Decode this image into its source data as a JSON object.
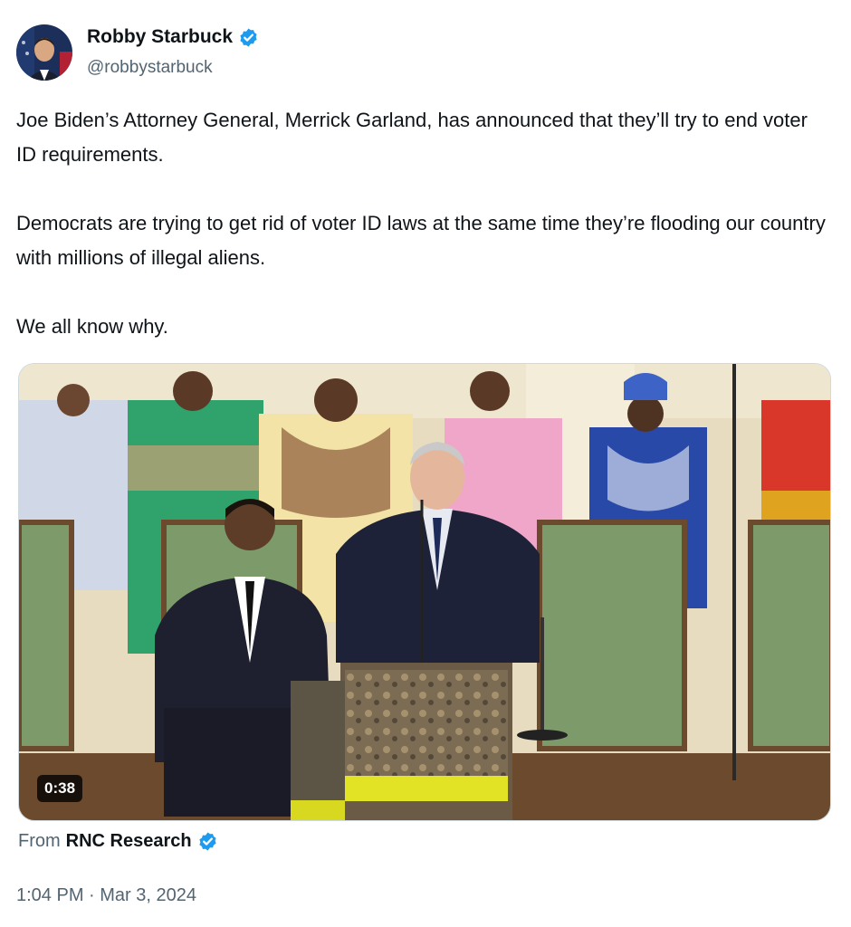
{
  "author": {
    "display_name": "Robby Starbuck",
    "handle": "@robbystarbuck",
    "verified": true
  },
  "text": {
    "paragraph_1": "Joe Biden’s Attorney General, Merrick Garland, has announced that they’ll try to end voter ID requirements.",
    "paragraph_2": "Democrats are trying to get rid of voter ID laws at the same time they’re flooding our country with millions of illegal aliens.",
    "paragraph_3": "We all know why."
  },
  "media": {
    "duration": "0:38"
  },
  "source": {
    "prefix": "From",
    "name": "RNC Research",
    "verified": true
  },
  "timestamp": "1:04 PM · Mar 3, 2024",
  "colors": {
    "verified_badge": "#1d9bf0",
    "secondary_text": "#536471",
    "primary_text": "#0f1419"
  }
}
